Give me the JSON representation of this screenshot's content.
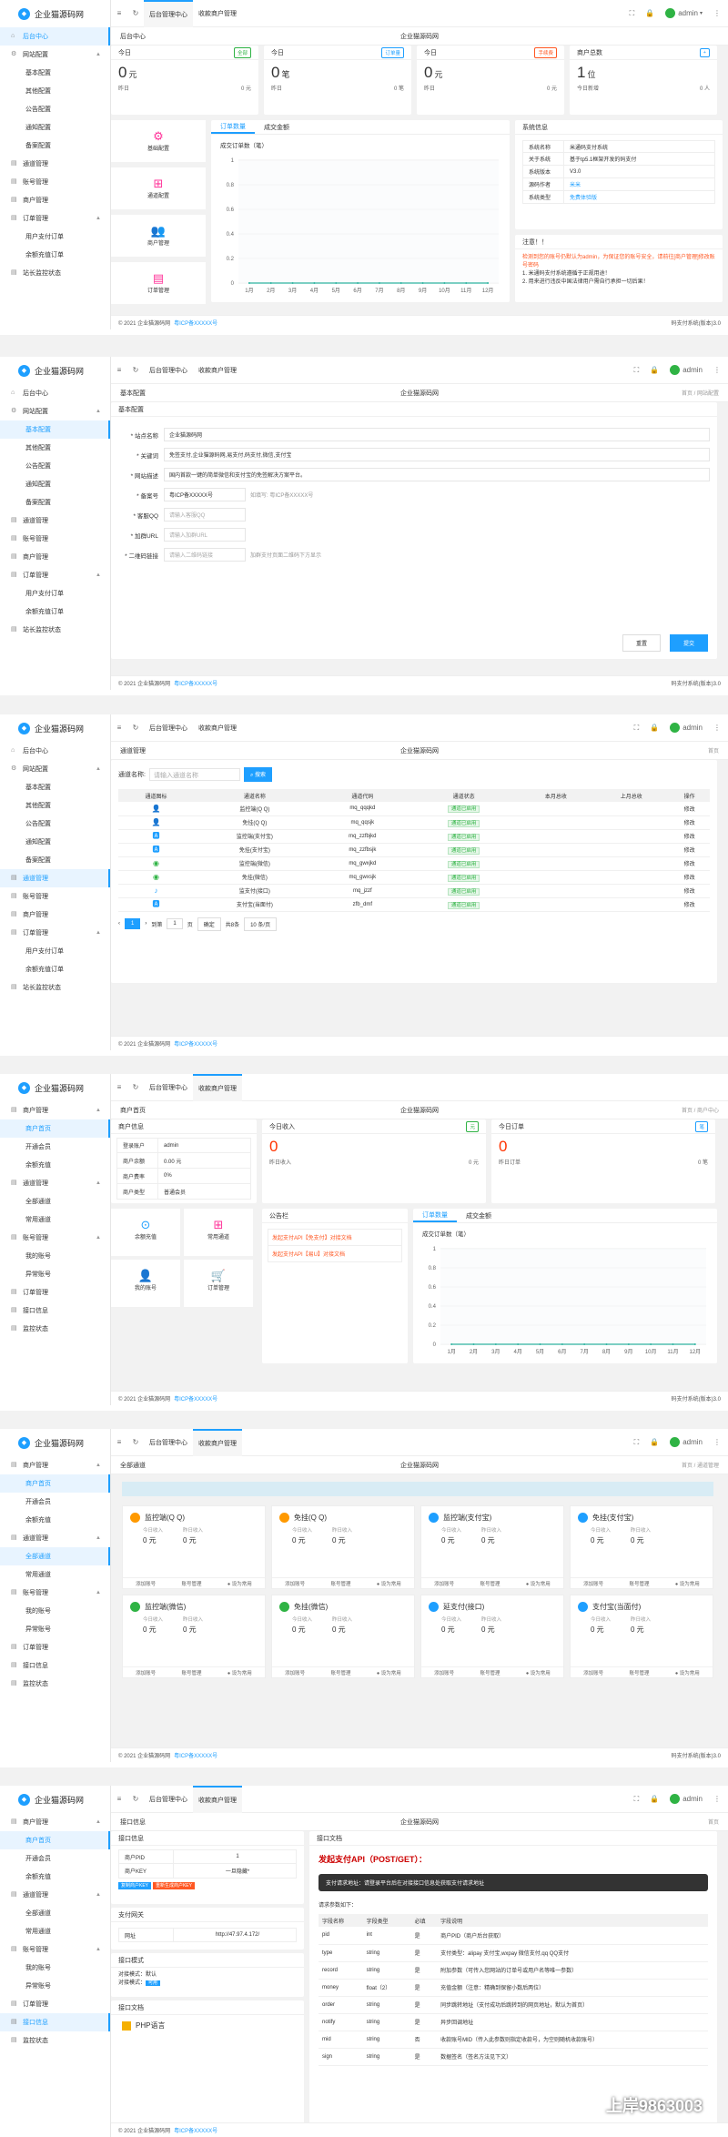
{
  "brand": "企业猫源码网",
  "user": "admin",
  "footer": {
    "copy": "© 2021 企业猫源码网",
    "icp": "粤ICP备XXXXX号",
    "ver": "码支付系统(版本)3.0"
  },
  "s1": {
    "nav": [
      {
        "icon": "⌂",
        "label": "后台中心"
      },
      {
        "icon": "⚙",
        "label": "网站配置",
        "arr": "▲"
      },
      {
        "sub": "基本配置"
      },
      {
        "sub": "其他配置"
      },
      {
        "sub": "公告配置"
      },
      {
        "sub": "通知配置"
      },
      {
        "sub": "备案配置"
      },
      {
        "icon": "▤",
        "label": "通道管理"
      },
      {
        "icon": "▤",
        "label": "账号管理"
      },
      {
        "icon": "▤",
        "label": "商户管理"
      },
      {
        "icon": "▤",
        "label": "订单管理",
        "arr": "▲"
      },
      {
        "sub": "用户支付订单"
      },
      {
        "sub": "余额充值订单"
      },
      {
        "icon": "▤",
        "label": "站长监控状态"
      }
    ],
    "tabs": [
      "后台管理中心",
      "收款商户管理"
    ],
    "crumb": "后台中心",
    "center": "企业猫源码网",
    "stats": [
      {
        "t": "今日",
        "tag": "全部",
        "c": "#2fb344",
        "v": "0",
        "u": "元",
        "l": "昨日",
        "r": "0 元"
      },
      {
        "t": "今日",
        "tag": "订单量",
        "c": "#1e9fff",
        "v": "0",
        "u": "笔",
        "l": "昨日",
        "r": "0 笔"
      },
      {
        "t": "今日",
        "tag": "手续费",
        "c": "#ff5722",
        "v": "0",
        "u": "元",
        "l": "昨日",
        "r": "0 元"
      },
      {
        "t": "商户总数",
        "tag": "+",
        "c": "#1e9fff",
        "v": "1",
        "u": "位",
        "l": "今日新增",
        "r": "0 人"
      }
    ],
    "quick": [
      "基础配置",
      "通道配置",
      "商户管理",
      "订单管理"
    ],
    "charttabs": [
      "订单数量",
      "成交金额"
    ],
    "charttitle": "成交订单数（笔）",
    "chart_data": {
      "type": "line",
      "title": "成交订单数（笔）",
      "categories": [
        "1月",
        "2月",
        "3月",
        "4月",
        "5月",
        "6月",
        "7月",
        "8月",
        "9月",
        "10月",
        "11月",
        "12月"
      ],
      "values": [
        0,
        0,
        0,
        0,
        0,
        0,
        0,
        0,
        0,
        0,
        0,
        0
      ],
      "ylim": [
        0,
        1
      ]
    },
    "sys": {
      "title": "系统信息",
      "rows": [
        [
          "系统名称",
          "米通码支付系统"
        ],
        [
          "关于系统",
          "基于tp5.1框架开发的码支付"
        ],
        [
          "系统版本",
          "V3.0"
        ],
        [
          "源码作者",
          "米米"
        ],
        [
          "系统类型",
          "免费体验版"
        ]
      ]
    },
    "notice": {
      "title": "注意！！",
      "red": "检测到您的账号仍默认为admin，为保证您的账号安全，请前往[商户管理]修改账号密码",
      "items": [
        "1. 米通码支付系统遵循于正规用途！",
        "2. 用来进行违反中国法律用户需自行承担一切后果！"
      ]
    }
  },
  "s2": {
    "crumb": "基本配置",
    "center": "企业猫源码网",
    "right": "首页 / 网站配置",
    "fields": [
      {
        "l": "* 站点名称",
        "v": "企业猫源码网"
      },
      {
        "l": "* 关键词",
        "v": "免签支付,企业猫源码网,易支付,码支付,微信,支付宝"
      },
      {
        "l": "* 网站描述",
        "v": "国内首款一键的简单微信和支付宝的免签解决方案平台。"
      },
      {
        "l": "* 备案号",
        "v": "粤ICP备XXXXX号",
        "tip": "如填写: 粤ICP备XXXXX号"
      },
      {
        "l": "* 客服QQ",
        "ph": "请输入客服QQ"
      },
      {
        "l": "* 加群URL",
        "ph": "请输入加群URL"
      },
      {
        "l": "* 二维码链接",
        "ph": "请输入二维码链接",
        "tip": "加群支付页面二维码下方显示"
      }
    ],
    "reset": "重置",
    "submit": "提交"
  },
  "s3": {
    "crumb": "通道管理",
    "center": "企业猫源码网",
    "right": "首页",
    "search_label": "通道名称:",
    "search_ph": "请输入通道名称",
    "search_btn": "搜索",
    "cols": [
      "通道图标",
      "通道名称",
      "通道代码",
      "通道状态",
      "本月总收",
      "上月总收",
      "操作"
    ],
    "rows": [
      [
        "👤",
        "监控端(Q Q)",
        "mq_qqqkd",
        "通道已启用",
        "",
        "",
        "修改"
      ],
      [
        "👤",
        "免挂(Q Q)",
        "mq_qqsjk",
        "通道已启用",
        "",
        "",
        "修改"
      ],
      [
        "🅰",
        "监控端(支付宝)",
        "mq_zzfbjkd",
        "通道已启用",
        "",
        "",
        "修改"
      ],
      [
        "🅰",
        "免挂(支付宝)",
        "mq_zzfbsjk",
        "通道已启用",
        "",
        "",
        "修改"
      ],
      [
        "◉",
        "监控端(微信)",
        "mq_gwxjkd",
        "通道已启用",
        "",
        "",
        "修改"
      ],
      [
        "◉",
        "免挂(微信)",
        "mq_gwxsjk",
        "通道已启用",
        "",
        "",
        "修改"
      ],
      [
        "♪",
        "监支付(接口)",
        "mq_jzzf",
        "通道已启用",
        "",
        "",
        "修改"
      ],
      [
        "🅰",
        "支付宝(当面付)",
        "zfb_dmf",
        "通道已启用",
        "",
        "",
        "修改"
      ]
    ],
    "pager": {
      "cur": "1",
      "goto": "到第",
      "page": "1",
      "unit": "页",
      "ok": "确定",
      "total": "共8条",
      "size": "10 条/页"
    }
  },
  "s4": {
    "nav": [
      {
        "icon": "▤",
        "label": "商户管理",
        "arr": "▲"
      },
      {
        "sub": "商户首页",
        "active": true
      },
      {
        "sub": "开通会员"
      },
      {
        "sub": "余额充值"
      },
      {
        "icon": "▤",
        "label": "通道管理",
        "arr": "▲"
      },
      {
        "sub": "全部通道"
      },
      {
        "sub": "常用通道"
      },
      {
        "icon": "▤",
        "label": "账号管理",
        "arr": "▲"
      },
      {
        "sub": "我的账号"
      },
      {
        "sub": "异常账号"
      },
      {
        "icon": "▤",
        "label": "订单管理"
      },
      {
        "icon": "▤",
        "label": "接口信息"
      },
      {
        "icon": "▤",
        "label": "监控状态"
      }
    ],
    "tabs": [
      "后台管理中心",
      "收款商户管理"
    ],
    "crumb": "商户首页",
    "center": "企业猫源码网",
    "right": "首页 / 商户中心",
    "info_title": "商户信息",
    "info": [
      [
        "登录账户",
        "admin"
      ],
      [
        "商户余额",
        "0.00 元"
      ],
      [
        "商户费率",
        "0%"
      ],
      [
        "商户类型",
        "普通会员"
      ]
    ],
    "stats": [
      {
        "t": "今日收入",
        "tag": "元",
        "c": "#2fb344",
        "v": "0",
        "l": "昨日收入",
        "r": "0 元"
      },
      {
        "t": "今日订单",
        "tag": "笔",
        "c": "#1e9fff",
        "v": "0",
        "l": "昨日订单",
        "r": "0 笔"
      }
    ],
    "quick": [
      "余额充值",
      "常用通道",
      "我的账号",
      "订单管理"
    ],
    "notice_title": "公告栏",
    "notices": [
      "发起支付API【免支付】对接文档",
      "发起支付API【易U】对接文档"
    ],
    "charttabs": [
      "订单数量",
      "成交金额"
    ],
    "charttitle": "成交订单数（笔）",
    "chart_data": {
      "type": "line",
      "title": "成交订单数（笔）",
      "categories": [
        "1月",
        "2月",
        "3月",
        "4月",
        "5月",
        "6月",
        "7月",
        "8月",
        "9月",
        "10月",
        "11月",
        "12月"
      ],
      "values": [
        0,
        0,
        0,
        0,
        0,
        0,
        0,
        0,
        0,
        0,
        0,
        0
      ],
      "ylim": [
        0,
        1
      ]
    }
  },
  "s5": {
    "crumb": "全部通道",
    "center": "企业猫源码网",
    "right": "首页 / 通道管理",
    "cards": [
      {
        "n": "监控端(Q Q)",
        "c": "#f90"
      },
      {
        "n": "免挂(Q Q)",
        "c": "#f90"
      },
      {
        "n": "监控端(支付宝)",
        "c": "#1e9fff"
      },
      {
        "n": "免挂(支付宝)",
        "c": "#1e9fff"
      },
      {
        "n": "监控端(微信)",
        "c": "#2fb344"
      },
      {
        "n": "免挂(微信)",
        "c": "#2fb344"
      },
      {
        "n": "延支付(接口)",
        "c": "#1e9fff"
      },
      {
        "n": "支付宝(当面付)",
        "c": "#1e9fff"
      }
    ],
    "lab1": "今日收入",
    "lab2": "昨日收入",
    "val": "0 元",
    "ops": [
      "添加账号",
      "账号管理",
      "● 设为常用"
    ]
  },
  "s6": {
    "crumb": "接口信息",
    "center": "企业猫源码网",
    "right": "首页",
    "pid_label": "商户PID",
    "pid": "1",
    "key_label": "商户KEY",
    "key": "一旦隐藏*",
    "btn1": "复制商户KEY",
    "btn2": "重新生成商户KEY",
    "gw_title": "支付网关",
    "gw_label": "网址",
    "gw": "http://47.97.4.172/",
    "mode_title": "接口模式",
    "mode1": "对接模式：默认",
    "mode2": "对接模式：",
    "mode2v": "可用",
    "doc_title": "接口文档",
    "php": "PHP语言",
    "right_title": "接口文档",
    "api": "发起支付API（POST/GET）：",
    "bar": "支付请求地址：请登录平台后在对接接口信息处获取支付请求地址",
    "params_title": "请求参数如下：",
    "cols": [
      "字段名称",
      "字段类型",
      "必填",
      "字段说明"
    ],
    "rows": [
      [
        "pid",
        "int",
        "是",
        "商户PID（商户后台获取）"
      ],
      [
        "type",
        "string",
        "是",
        "支付类型：alipay 支付宝,wxpay 微信支付,qq QQ支付"
      ],
      [
        "record",
        "string",
        "是",
        "附加参数（可传入您网站的订单号或用户名等唯一参数）"
      ],
      [
        "money",
        "float（2）",
        "是",
        "充值金额（注意：精确到保留小数后两位）"
      ],
      [
        "order",
        "string",
        "是",
        "同步跳转地址（支付成功后跳转到的网页地址，默认为首页）"
      ],
      [
        "notify",
        "string",
        "是",
        "异步回调地址"
      ],
      [
        "mid",
        "string",
        "否",
        "收款账号MID（传入此参数则指定收款号，为空则随机收款账号）"
      ],
      [
        "sign",
        "string",
        "是",
        "数据签名（签名方法见下文）"
      ]
    ],
    "watermark": "上岸9863003"
  }
}
